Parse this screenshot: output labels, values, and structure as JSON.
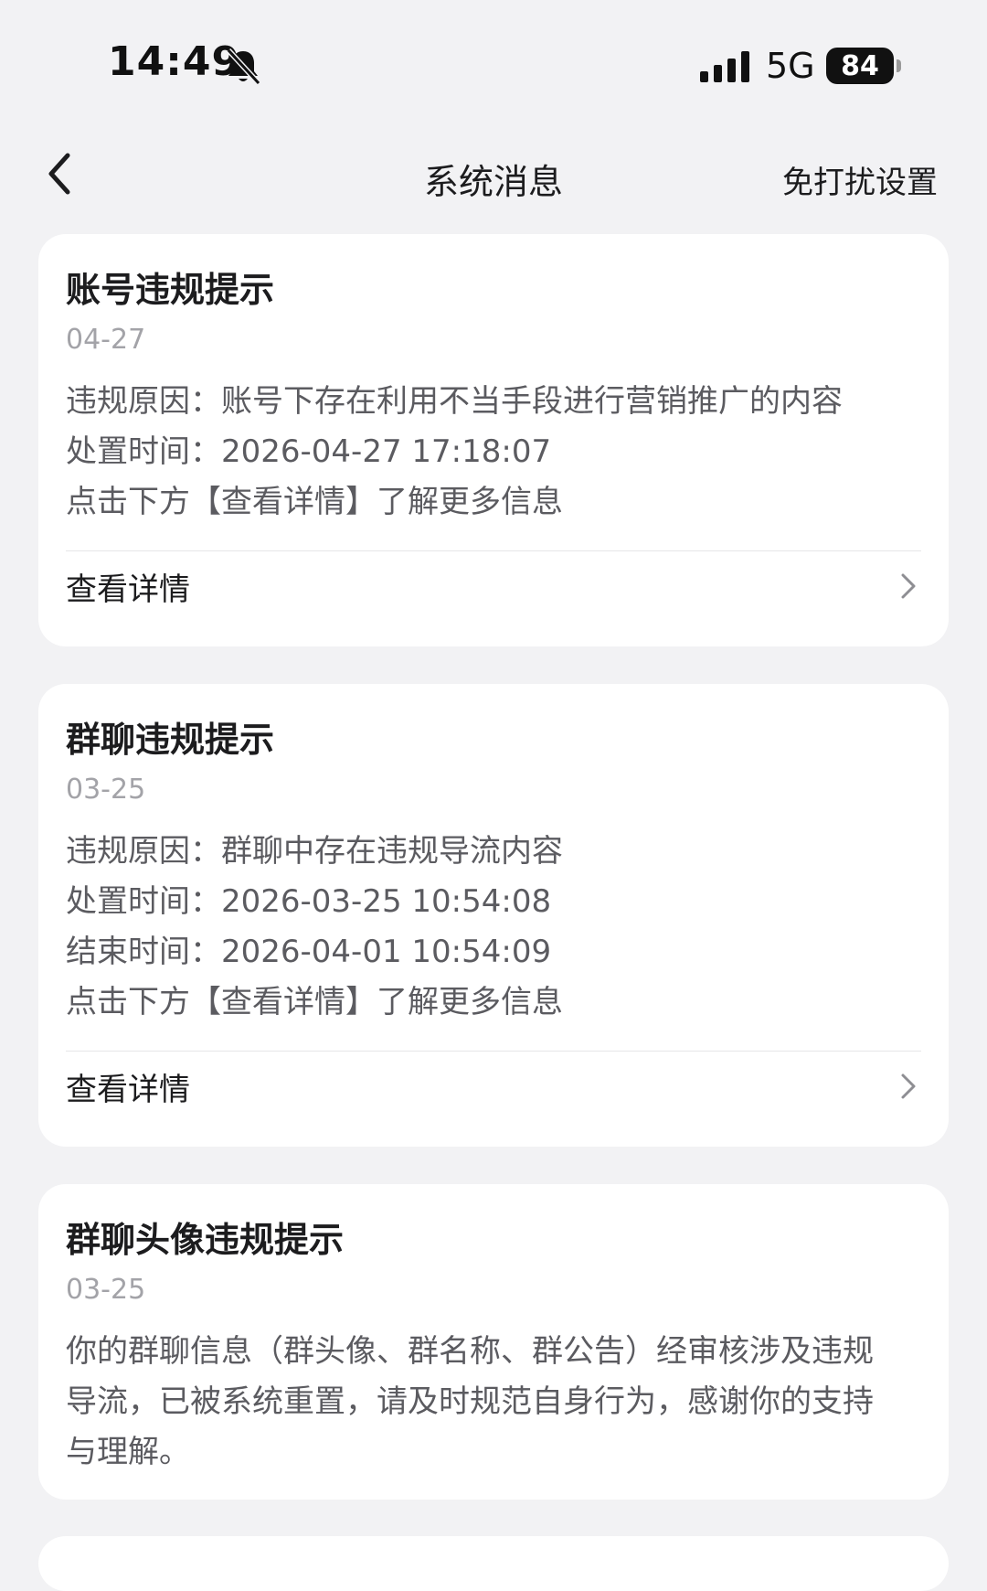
{
  "status_bar": {
    "time": "14:49",
    "network": "5G",
    "battery": "84"
  },
  "nav": {
    "title": "系统消息",
    "action_label": "免打扰设置"
  },
  "cards": [
    {
      "title": "账号违规提示",
      "date": "04-27",
      "lines": [
        "违规原因：账号下存在利用不当手段进行营销推广的内容",
        "处置时间：2026-04-27 17:18:07",
        "点击下方【查看详情】了解更多信息"
      ],
      "detail_label": "查看详情"
    },
    {
      "title": "群聊违规提示",
      "date": "03-25",
      "lines": [
        "违规原因：群聊中存在违规导流内容",
        "处置时间：2026-03-25 10:54:08",
        "结束时间：2026-04-01 10:54:09",
        "点击下方【查看详情】了解更多信息"
      ],
      "detail_label": "查看详情"
    },
    {
      "title": "群聊头像违规提示",
      "date": "03-25",
      "paragraph": "你的群聊信息（群头像、群名称、群公告）经审核涉及违规导流，已被系统重置，请及时规范自身行为，感谢你的支持与理解。"
    }
  ]
}
